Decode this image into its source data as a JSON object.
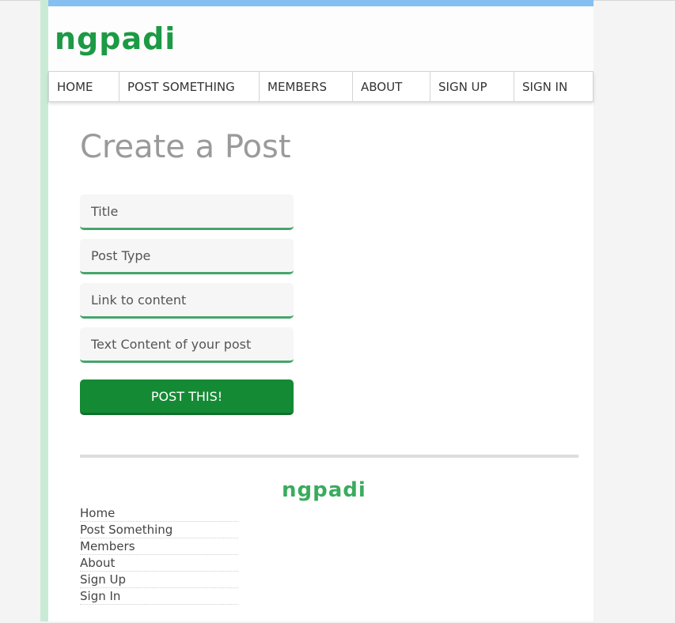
{
  "brand": {
    "logo_text": "ngpadi",
    "accent_color": "#1c9a44",
    "header_bar_color": "#86bff2"
  },
  "nav": {
    "items": [
      {
        "label": "HOME"
      },
      {
        "label": "POST SOMETHING"
      },
      {
        "label": "MEMBERS"
      },
      {
        "label": "ABOUT"
      },
      {
        "label": "SIGN UP"
      },
      {
        "label": "SIGN IN"
      }
    ]
  },
  "form": {
    "title": "Create a Post",
    "fields": [
      {
        "placeholder": "Title"
      },
      {
        "placeholder": "Post Type"
      },
      {
        "placeholder": "Link to content"
      },
      {
        "placeholder": "Text Content of your post"
      }
    ],
    "submit_label": "POST THIS!",
    "submit_color": "#158a35"
  },
  "footer": {
    "logo_text": "ngpadi",
    "links": [
      {
        "label": "Home"
      },
      {
        "label": "Post Something"
      },
      {
        "label": "Members"
      },
      {
        "label": "About"
      },
      {
        "label": "Sign Up"
      },
      {
        "label": "Sign In"
      }
    ]
  }
}
